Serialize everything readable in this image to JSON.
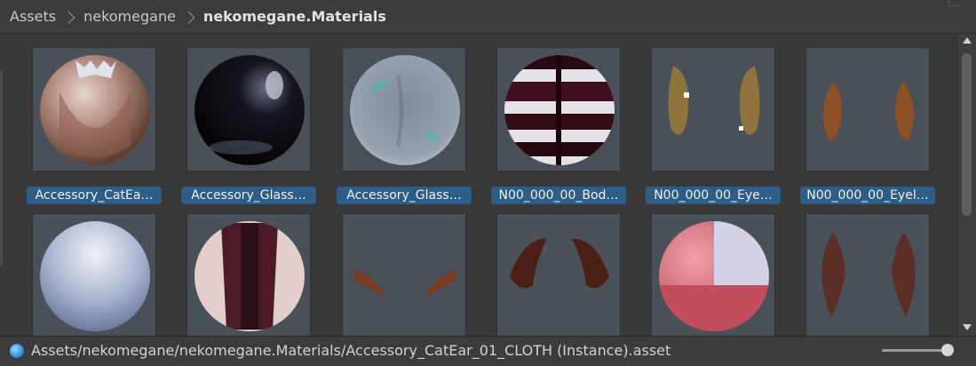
{
  "breadcrumb": {
    "items": [
      "Assets",
      "nekomegane",
      "nekomegane.Materials"
    ]
  },
  "materials": [
    {
      "label": "Accessory_CatEa…",
      "preview": "cat-ear-sphere-preview",
      "selected": true
    },
    {
      "label": "Accessory_Glass…",
      "preview": "black-glossy-sphere-preview",
      "selected": true
    },
    {
      "label": "Accessory_Glass…",
      "preview": "transparent-glass-sphere-preview",
      "selected": true
    },
    {
      "label": "N00_000_00_Bod…",
      "preview": "striped-body-sphere-preview",
      "selected": true
    },
    {
      "label": "N00_000_00_Eye…",
      "preview": "eye-highlight-preview",
      "selected": true
    },
    {
      "label": "N00_000_00_Eyel…",
      "preview": "eyelash-brown-preview",
      "selected": true
    },
    {
      "label": "",
      "preview": "pale-blue-sphere-preview",
      "selected": false
    },
    {
      "label": "",
      "preview": "clothing-sphere-preview",
      "selected": false
    },
    {
      "label": "",
      "preview": "eyebrow-preview",
      "selected": false
    },
    {
      "label": "",
      "preview": "dark-hair-strands-preview",
      "selected": false
    },
    {
      "label": "",
      "preview": "pink-white-sphere-preview",
      "selected": false
    },
    {
      "label": "",
      "preview": "hair-curve-preview",
      "selected": false
    }
  ],
  "status": {
    "icon": "material-sphere-icon",
    "path": "Assets/nekomegane/nekomegane.Materials/Accessory_CatEar_01_CLOTH (Instance).asset"
  },
  "zoom_slider": {
    "value": 1.0
  },
  "colors": {
    "selection": "#2c5d87",
    "background": "#383838",
    "thumbnail": "#4a5058"
  }
}
